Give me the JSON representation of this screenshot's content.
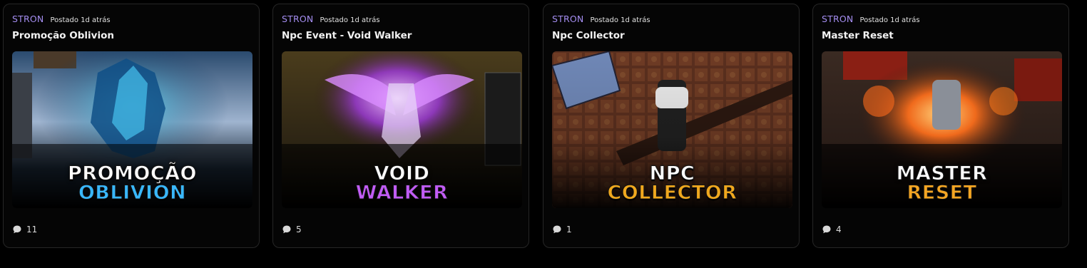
{
  "posts": [
    {
      "author": "STRON",
      "posted": "Postado 1d atrás",
      "title": "Promoção Oblivion",
      "banner_line1": "PROMOÇÃO",
      "banner_line2": "OBLIVION",
      "banner_line2_color": "#39b8ff",
      "comment_icon": "comment-bubble-icon",
      "comments": "11"
    },
    {
      "author": "STRON",
      "posted": "Postado 1d atrás",
      "title": "Npc Event - Void Walker",
      "banner_line1": "VOID",
      "banner_line2": "WALKER",
      "banner_line2_color": "#c15cf5",
      "comment_icon": "comment-bubble-icon",
      "comments": "5"
    },
    {
      "author": "STRON",
      "posted": "Postado 1d atrás",
      "title": "Npc Collector",
      "banner_line1": "NPC",
      "banner_line2": "COLLECTOR",
      "banner_line2_color": "#f0a81e",
      "comment_icon": "comment-bubble-icon",
      "comments": "1"
    },
    {
      "author": "STRON",
      "posted": "Postado 1d atrás",
      "title": "Master Reset",
      "banner_line1": "MASTER",
      "banner_line2": "RESET",
      "banner_line2_color": "#f5a623",
      "comment_icon": "comment-bubble-icon",
      "comments": "4"
    }
  ],
  "colors": {
    "background": "#000000",
    "card_border": "#262626",
    "author": "#a48df0"
  }
}
